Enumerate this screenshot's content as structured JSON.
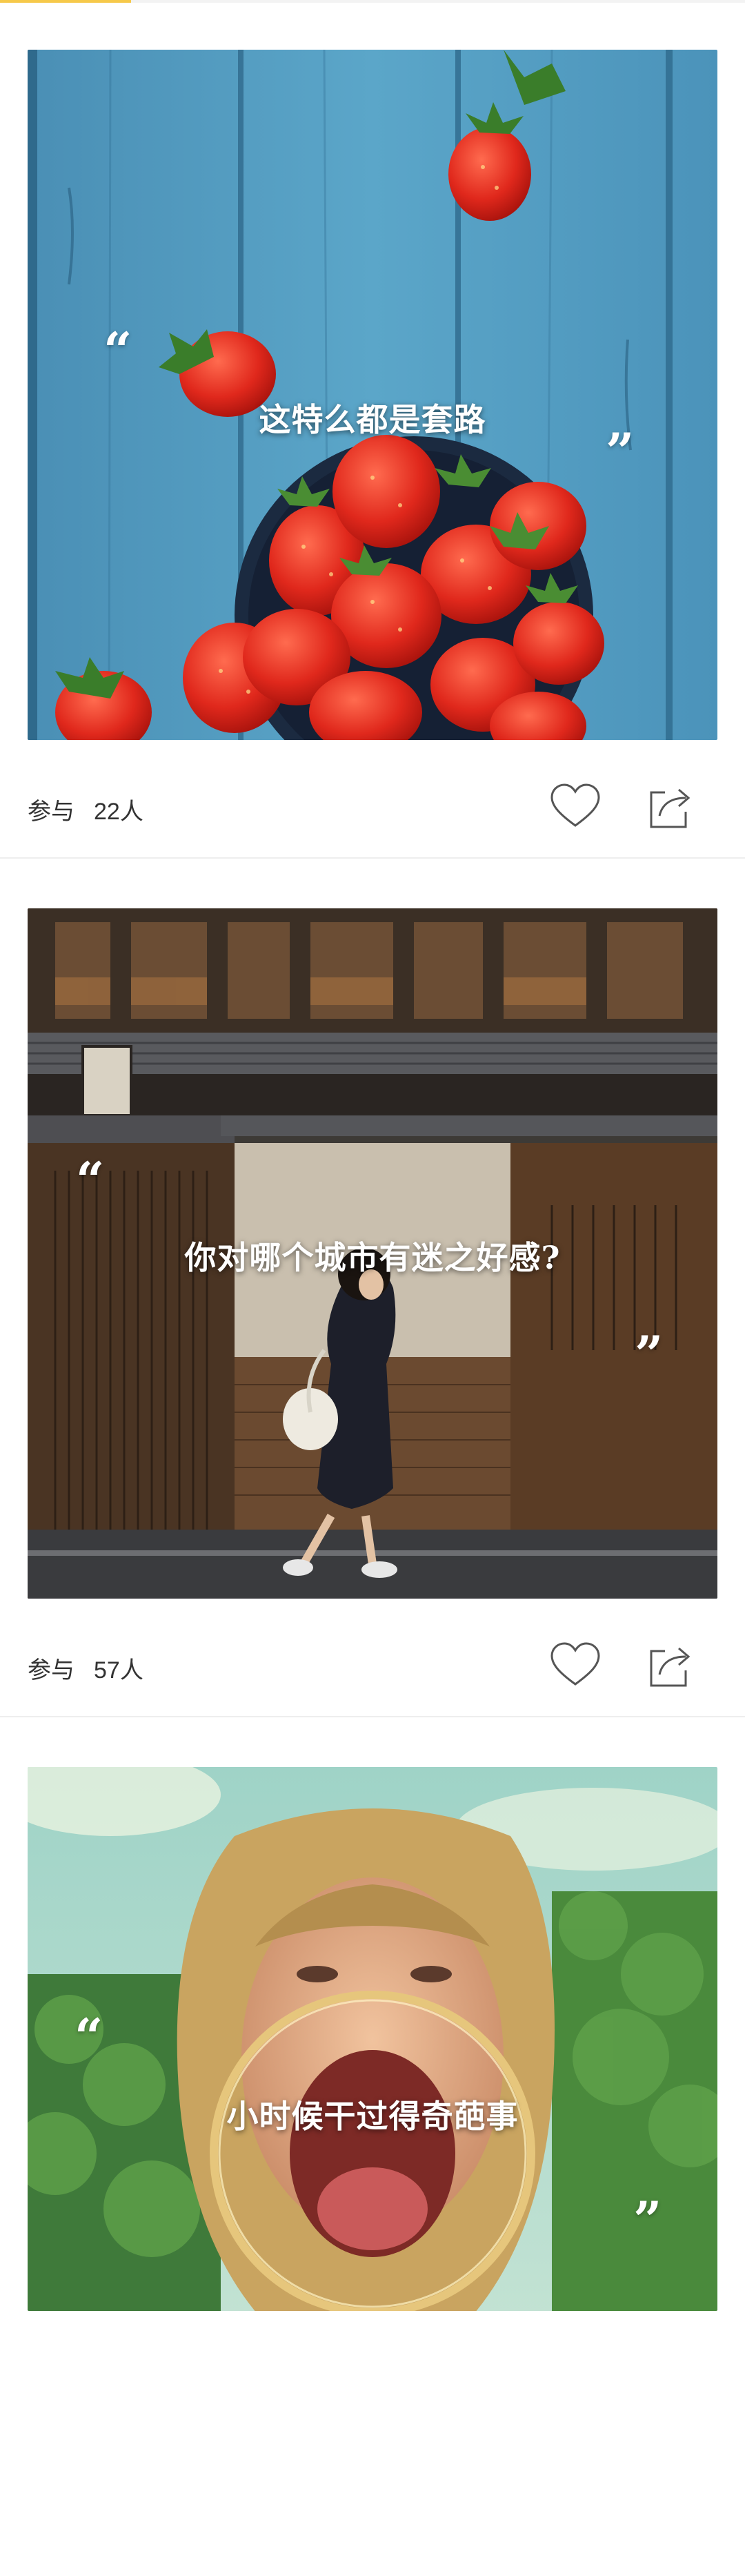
{
  "header": {
    "accent_color": "#f6c94a"
  },
  "cards": [
    {
      "caption": "这特么都是套路",
      "participants_label": "参与",
      "participants_count": "22人",
      "like_icon": "heart-outline-icon",
      "share_icon": "share-out-icon"
    },
    {
      "caption": "你对哪个城市有迷之好感?",
      "participants_label": "参与",
      "participants_count": "57人",
      "like_icon": "heart-outline-icon",
      "share_icon": "share-out-icon"
    },
    {
      "caption": "小时候干过得奇葩事"
    }
  ],
  "quote_marks": {
    "open": "“",
    "close": "”"
  },
  "colors": {
    "text_primary": "#333333",
    "divider": "#eeeeee",
    "icon_stroke": "#555555"
  }
}
